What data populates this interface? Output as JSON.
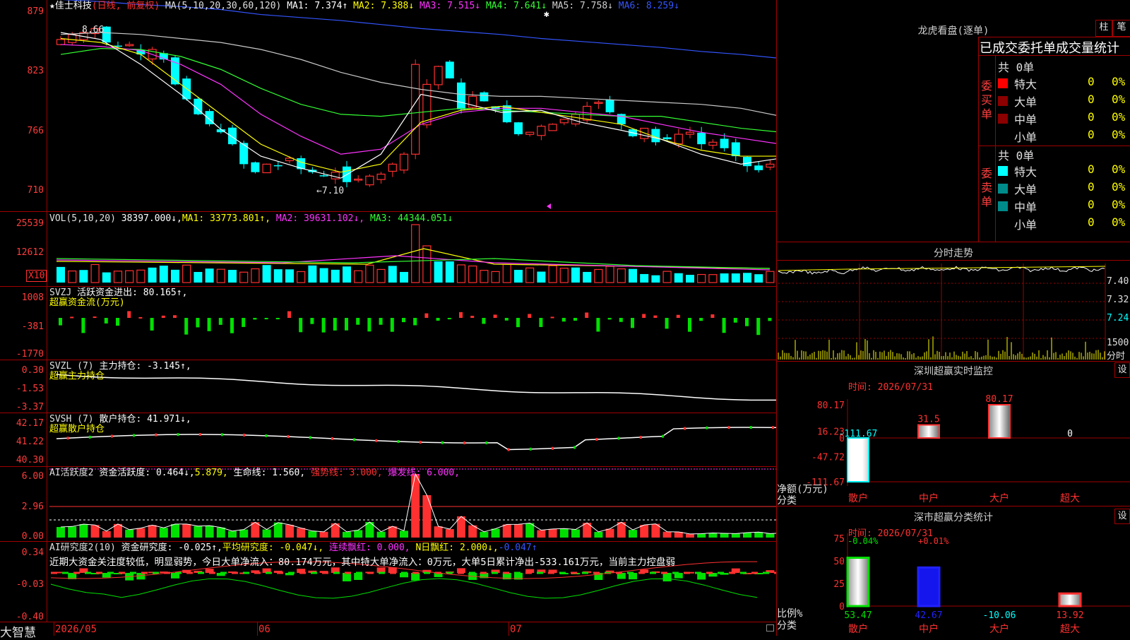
{
  "main": {
    "title_prefix": "★",
    "stock_name": "佳士科技",
    "period": "(日线, 前复权)",
    "ma_label": "MA(5,10,20,30,60,120)",
    "ma1": "MA1: 7.374↑",
    "ma2": "MA2: 7.388↓",
    "ma3": "MA3: 7.515↓",
    "ma4": "MA4: 7.641↓",
    "ma5": "MA5: 7.758↓",
    "ma6": "MA6: 8.259↓",
    "high_mark": "8.66",
    "low_mark": "←7.10",
    "y_ticks": [
      "879",
      "823",
      "766",
      "710"
    ]
  },
  "vol": {
    "label": "VOL(5,10,20)",
    "value": "38397.000↓,",
    "ma1": "MA1: 33773.801↑,",
    "ma2": "MA2: 39631.102↓,",
    "ma3": "MA3: 44344.051↓",
    "y_ticks": [
      "25539",
      "12612"
    ],
    "unit": "X10"
  },
  "svzj": {
    "label": "SVZJ",
    "line": "活跃资金进出: 80.165↑,",
    "sub": "超赢资金流(万元)",
    "y_ticks": [
      "1008",
      "-381",
      "-1770"
    ]
  },
  "svzl": {
    "label": "SVZL (7)",
    "line": "主力持仓: -3.145↑,",
    "sub": "超赢主力持仓",
    "y_ticks": [
      "0.30",
      "-1.53",
      "-3.37"
    ]
  },
  "svsh": {
    "label": "SVSH (7)",
    "line": "散户持仓: 41.971↓,",
    "sub": "超赢散户持仓",
    "y_ticks": [
      "42.17",
      "41.22",
      "40.30"
    ]
  },
  "ai1": {
    "label": "AI活跃度2",
    "part1": "资金活跃度: 0.464↓,",
    "part2": "5.879,",
    "part3": "生命线: 1.560,",
    "part4": "强势线: 3.000,",
    "part5": "爆发线: 6.000,",
    "y_ticks": [
      "6.00",
      "2.96",
      "0.00"
    ]
  },
  "ai2": {
    "label": "AI研究度2(10)",
    "part1": "资金研究度: -0.025↑,",
    "part2": "平均研究度: -0.047↓,",
    "part3": "连续飘红: 0.000,",
    "part4": "N日飘红: 2.000↓,",
    "part5": "-0.047↑",
    "desc": "近期大资金关注度较低，明显弱势，今日大单净流入：80.174万元，其中特大单净流入：0万元，大单5日累计净出-533.161万元，当前主力控盘弱",
    "y_ticks": [
      "0.34",
      "-0.03",
      "-0.40"
    ]
  },
  "bottom": {
    "brand": "大智慧",
    "dates": [
      "2026/05",
      "06",
      "07"
    ]
  },
  "dragon": {
    "title": "龙虎看盘(逐单)",
    "btn1": "柱",
    "btn2": "笔",
    "header": "已成交委托单成交量统计",
    "buy_label": "委买单",
    "sell_label": "委卖单",
    "buy_total": "共 0单",
    "sell_total": "共 0单",
    "rows": [
      {
        "name": "特大",
        "count": "0",
        "pct": "0%"
      },
      {
        "name": "大单",
        "count": "0",
        "pct": "0%"
      },
      {
        "name": "中单",
        "count": "0",
        "pct": "0%"
      },
      {
        "name": "小单",
        "count": "0",
        "pct": "0%"
      }
    ],
    "buy_colors": [
      "#ff0000",
      "#8b0000",
      "#8b0000",
      "#000000"
    ],
    "sell_colors": [
      "#00ffff",
      "#008b8b",
      "#008b8b",
      "#000000"
    ]
  },
  "intraday": {
    "title": "分时走势",
    "y_ticks": [
      "7.40",
      "7.32",
      "7.24",
      "1500"
    ],
    "unit": "分时"
  },
  "monitor": {
    "title": "深圳超赢实时监控",
    "btn": "设",
    "time": "时间: 2026/07/31",
    "y_ticks": [
      "80.17",
      "16.23",
      "0",
      "-47.72",
      "-111.67"
    ],
    "bars": [
      {
        "cat": "散户",
        "value": -111.67,
        "label": "-111.67"
      },
      {
        "cat": "中户",
        "value": 31.5,
        "label": "31.5"
      },
      {
        "cat": "大户",
        "value": 80.17,
        "label": "80.17"
      },
      {
        "cat": "超大",
        "value": 0,
        "label": "0"
      }
    ],
    "ylabel": "净额(万元)",
    "xlabel": "分类"
  },
  "stats": {
    "title": "深市超赢分类统计",
    "btn": "设",
    "time": "时间: 2026/07/31",
    "y_ticks": [
      "75",
      "50",
      "25",
      "0"
    ],
    "bars": [
      {
        "cat": "散户",
        "value": 53.47,
        "label": "53.47",
        "top": "-0.04%"
      },
      {
        "cat": "中户",
        "value": 42.67,
        "label": "42.67",
        "top": "+0.01%"
      },
      {
        "cat": "大户",
        "value": 0,
        "label": "-10.06",
        "top": ""
      },
      {
        "cat": "超大",
        "value": 13.92,
        "label": "13.92",
        "top": ""
      }
    ],
    "ylabel": "比例%",
    "xlabel": "分类"
  },
  "colors": {
    "up": "#ff3030",
    "down": "#00ffff",
    "grid": "#a00000"
  }
}
